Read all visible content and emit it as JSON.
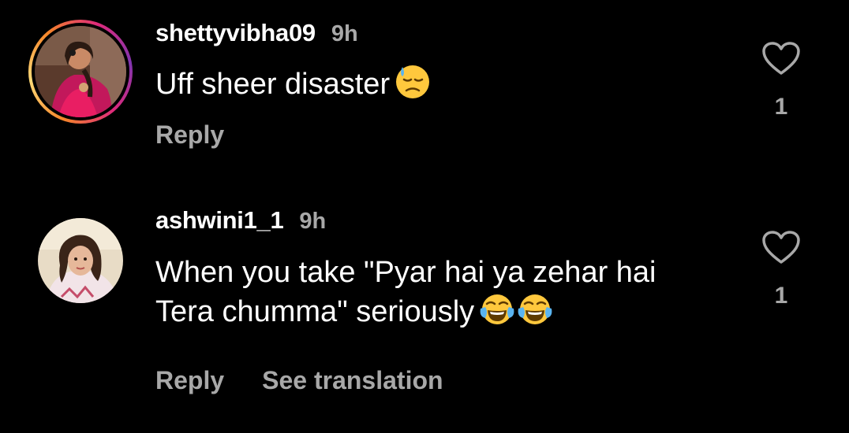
{
  "comments": [
    {
      "username": "shettyvibha09",
      "time": "9h",
      "lines": [
        "Uff sheer disaster"
      ],
      "emojis": [
        "downcast-face-with-sweat"
      ],
      "actions": [
        "Reply"
      ],
      "likes": "1",
      "avatar_ring": true
    },
    {
      "username": "ashwini1_1",
      "time": "9h",
      "lines": [
        "When you take \"Pyar hai ya zehar hai",
        "Tera chumma\" seriously"
      ],
      "emojis": [
        "face-with-tears-of-joy",
        "face-with-tears-of-joy"
      ],
      "actions": [
        "Reply",
        "See translation"
      ],
      "likes": "1",
      "avatar_ring": false
    }
  ],
  "colors": {
    "background": "#000000",
    "text": "#ffffff",
    "secondary": "#a8a8a8"
  }
}
